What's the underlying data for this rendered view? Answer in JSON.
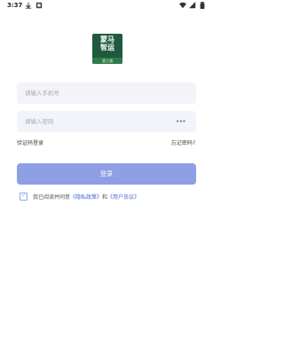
{
  "status_bar": {
    "time": "3:37",
    "left_icons": [
      "download-icon",
      "notification-icon"
    ],
    "right_icons": [
      "wifi-icon",
      "signal-icon",
      "battery-icon"
    ]
  },
  "logo": {
    "text": "蒙马\n智运",
    "tag": "管工通"
  },
  "form": {
    "phone_placeholder": "请输入手机号",
    "password_placeholder": "请输入密码",
    "password_toggle": "•••"
  },
  "links": {
    "sms_login": "验证码登录",
    "forgot_password": "忘记密码?"
  },
  "login_button": "登录",
  "agreement": {
    "prefix": "我已阅读并同意",
    "privacy": "《隐私政策》",
    "and": "和",
    "user_agreement": "《用户协议》"
  },
  "colors": {
    "accent": "#8f9fe6",
    "link": "#4766d8"
  }
}
